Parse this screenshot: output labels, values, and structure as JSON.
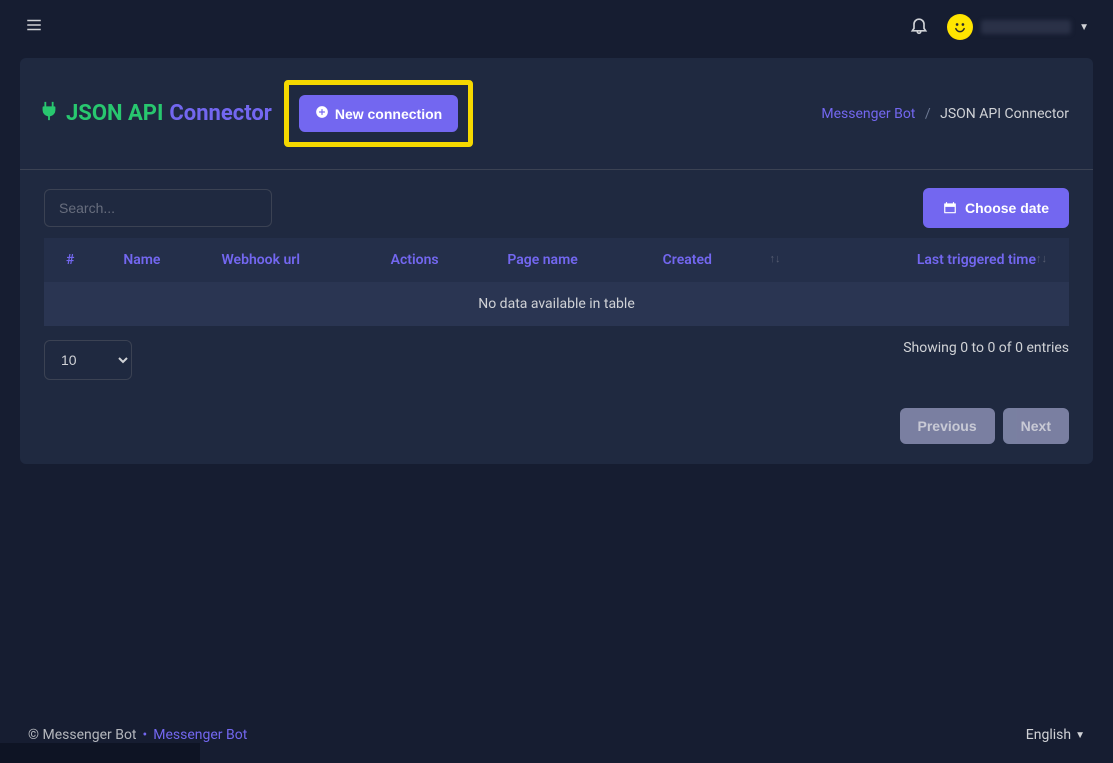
{
  "header": {
    "title_part1": "JSON API",
    "title_part2": "Connector",
    "new_connection_label": "New connection"
  },
  "breadcrumb": {
    "parent": "Messenger Bot",
    "current": "JSON API Connector"
  },
  "search": {
    "placeholder": "Search..."
  },
  "buttons": {
    "choose_date": "Choose date"
  },
  "table": {
    "columns": [
      "#",
      "Name",
      "Webhook url",
      "Actions",
      "Page name",
      "Created",
      "Last triggered time"
    ],
    "empty": "No data available in table"
  },
  "pagination": {
    "page_size_selected": "10",
    "info": "Showing 0 to 0 of 0 entries",
    "prev": "Previous",
    "next": "Next"
  },
  "footer": {
    "copyright": "© Messenger Bot",
    "link": "Messenger Bot",
    "language": "English"
  }
}
